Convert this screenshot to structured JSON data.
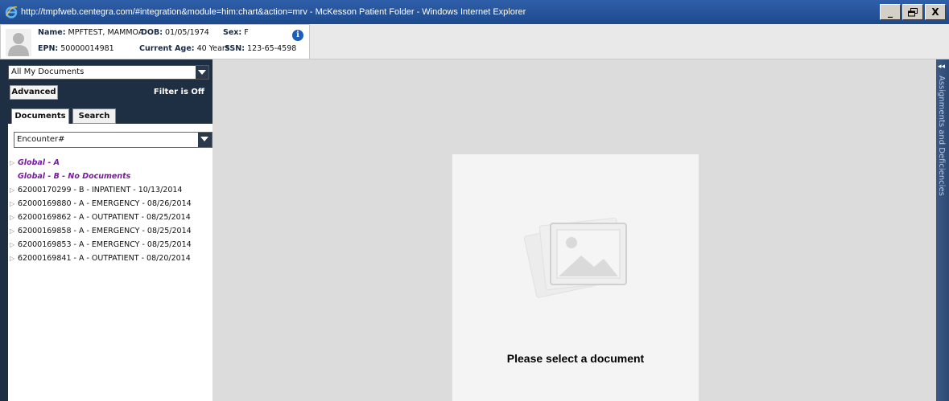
{
  "window": {
    "title": "http://tmpfweb.centegra.com/#integration&module=him:chart&action=mrv - McKesson Patient Folder - Windows Internet Explorer",
    "minimize": "_",
    "restore": "ё",
    "close": "X"
  },
  "patient": {
    "name_label": "Name:",
    "name": "MPFTEST, MAMMOA",
    "dob_label": "DOB:",
    "dob": "01/05/1974",
    "sex_label": "Sex:",
    "sex": "F",
    "epn_label": "EPN:",
    "epn": "50000014981",
    "age_label": "Current Age:",
    "age": "40 Years",
    "ssn_label": "SSN:",
    "ssn": "123-65-4598",
    "info_glyph": "i"
  },
  "sidebar": {
    "document_filter": "All My Documents",
    "advanced_label": "Advanced",
    "filter_status": "Filter is Off",
    "tabs": [
      "Documents",
      "Search"
    ],
    "group_by": "Encounter#",
    "tree": [
      {
        "label": "Global - A",
        "type": "global",
        "expandable": true
      },
      {
        "label": "Global - B - No Documents",
        "type": "global",
        "expandable": false
      },
      {
        "label": "62000170299 - B - INPATIENT - 10/13/2014",
        "type": "encounter",
        "expandable": true
      },
      {
        "label": "62000169880 - A - EMERGENCY - 08/26/2014",
        "type": "encounter",
        "expandable": true
      },
      {
        "label": "62000169862 - A - OUTPATIENT - 08/25/2014",
        "type": "encounter",
        "expandable": true
      },
      {
        "label": "62000169858 - A - EMERGENCY - 08/25/2014",
        "type": "encounter",
        "expandable": true
      },
      {
        "label": "62000169853 - A - EMERGENCY - 08/25/2014",
        "type": "encounter",
        "expandable": true
      },
      {
        "label": "62000169841 - A - OUTPATIENT - 08/20/2014",
        "type": "encounter",
        "expandable": true
      }
    ]
  },
  "viewer": {
    "message": "Please select a document",
    "placeholder_icon": "image-placeholder-icon"
  },
  "right_panel": {
    "label": "Assignments and Deficiencies",
    "collapse_glyph": "◂◂"
  }
}
